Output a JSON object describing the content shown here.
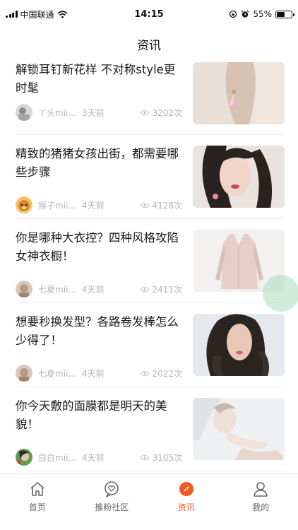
{
  "status_bar": {
    "carrier": "中国联通",
    "time": "14:15",
    "battery_percent": "55%",
    "battery_level": 0.55
  },
  "nav": {
    "title": "资讯"
  },
  "articles": [
    {
      "title": "解锁耳钉新花样 不对称style更时髦",
      "author": "丫头mii...",
      "time": "3天前",
      "views": "3202次"
    },
    {
      "title": "精致的猪猪女孩出街，都需要哪些步骤",
      "author": "猴子mii...",
      "time": "4天前",
      "views": "4128次"
    },
    {
      "title": "你是哪种大衣控？四种风格攻陷女神衣橱！",
      "author": "七夏mii...",
      "time": "4天前",
      "views": "2411次"
    },
    {
      "title": "想要秒换发型？各路卷发棒怎么少得了！",
      "author": "七夏mii...",
      "time": "4天前",
      "views": "2022次"
    },
    {
      "title": "你今天敷的面膜都是明天的美貌！",
      "author": "白白mii...",
      "time": "4天前",
      "views": "3105次"
    }
  ],
  "tabs": [
    {
      "label": "首页",
      "icon": "home-icon"
    },
    {
      "label": "推粉社区",
      "icon": "community-icon"
    },
    {
      "label": "资讯",
      "icon": "compass-icon",
      "active": true
    },
    {
      "label": "我的",
      "icon": "profile-icon"
    }
  ],
  "colors": {
    "accent": "#ef5a24",
    "muted_text": "#b4b4b4",
    "divider": "#ececec"
  }
}
